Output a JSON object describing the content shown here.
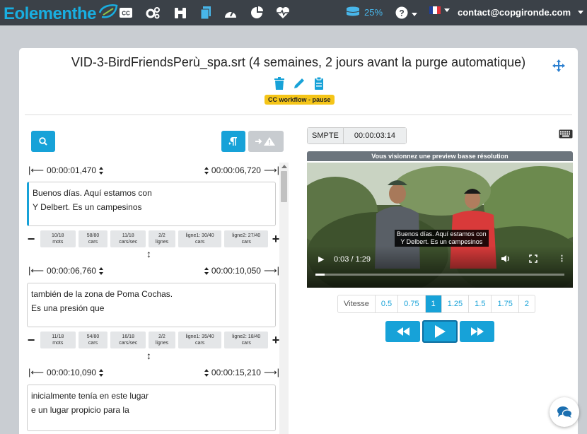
{
  "brand": {
    "name": "Eolementhe"
  },
  "navbar": {
    "icons": [
      "cc-icon",
      "cogs-icon",
      "binoculars-icon",
      "files-icon",
      "tachometer-icon",
      "pie-chart-icon",
      "heartbeat-icon"
    ],
    "quota": "25%",
    "account": "contact@copgironde.com"
  },
  "file": {
    "title": "VID-3-BirdFriendsPerù_spa.srt (4 semaines, 2 jours avant la purge automatique)",
    "badge": "CC workflow - pause"
  },
  "subtitles": [
    {
      "start": "00:00:01,470",
      "end": "00:00:06,720",
      "lines": [
        "Buenos días. Aquí estamos con",
        "Y Delbert. Es un campesinos"
      ],
      "stats": [
        [
          "10/18",
          "mots"
        ],
        [
          "58/80",
          "cars"
        ],
        [
          "11/18",
          "cars/sec"
        ],
        [
          "2/2",
          "lignes"
        ],
        [
          "ligne1: 30/40",
          "cars"
        ],
        [
          "ligne2: 27/40",
          "cars"
        ]
      ]
    },
    {
      "start": "00:00:06,760",
      "end": "00:00:10,050",
      "lines": [
        "también de la zona de Poma Cochas.",
        "Es una presión que"
      ],
      "stats": [
        [
          "11/18",
          "mots"
        ],
        [
          "54/80",
          "cars"
        ],
        [
          "16/18",
          "cars/sec"
        ],
        [
          "2/2",
          "lignes"
        ],
        [
          "ligne1: 35/40",
          "cars"
        ],
        [
          "ligne2: 18/40",
          "cars"
        ]
      ]
    },
    {
      "start": "00:00:10,090",
      "end": "00:00:15,210",
      "lines": [
        "inicialmente tenía en este lugar",
        "e un lugar propicio para la"
      ]
    }
  ],
  "player": {
    "smpte_label": "SMPTE",
    "smpte_value": "00:00:03:14",
    "preview_note": "Vous visionnez une preview basse résolution",
    "overlay_lines": [
      "Buenos días. Aquí estamos con",
      "Y Delbert. Es un campesinos"
    ],
    "time": "0:03 / 1:29",
    "progress": 0.036,
    "speed_label": "Vitesse",
    "speeds": [
      "0.5",
      "0.75",
      "1",
      "1.25",
      "1.5",
      "1.75",
      "2"
    ],
    "selected_speed": "1"
  }
}
